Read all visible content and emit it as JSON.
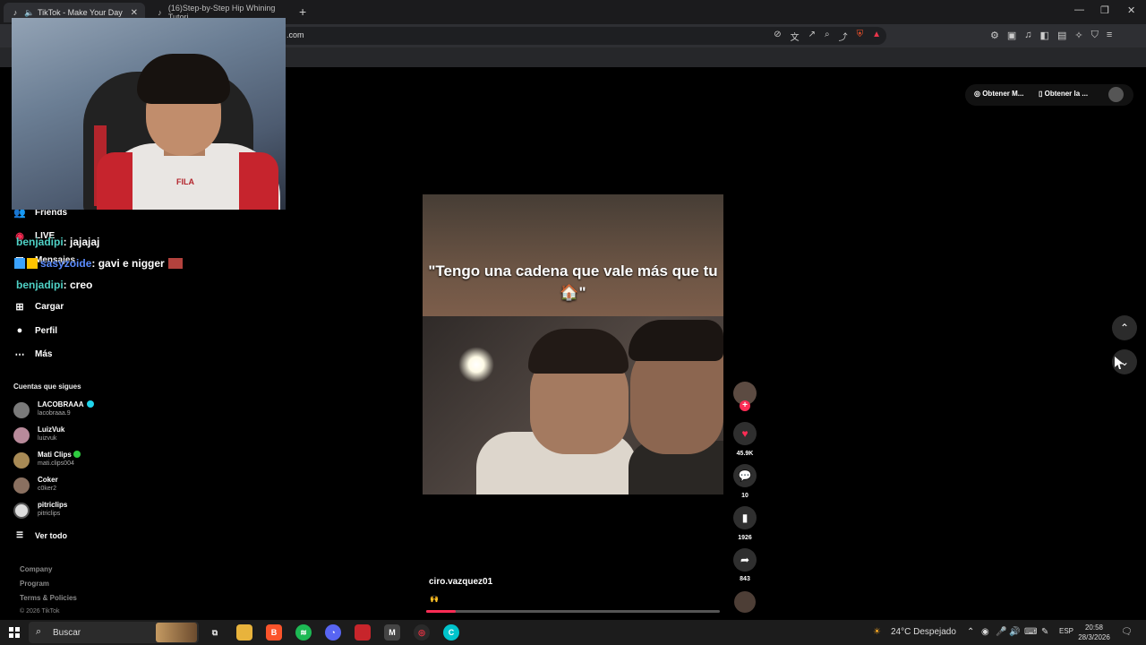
{
  "browser": {
    "tabs": [
      {
        "title": "TikTok - Make Your Day",
        "active": true
      },
      {
        "title": "(16)Step-by-Step Hip Whining Tutori",
        "active": false
      }
    ],
    "url_suffix": ".com",
    "new_tab_icon": "+"
  },
  "sidebar": {
    "items": [
      {
        "label": "Friends",
        "icon": "friends-icon"
      },
      {
        "label": "LIVE",
        "icon": "live-icon"
      },
      {
        "label": "Mensajes",
        "icon": "message-icon"
      },
      {
        "label": "Cargar",
        "icon": "upload-icon"
      },
      {
        "label": "Perfil",
        "icon": "profile-icon"
      },
      {
        "label": "Más",
        "icon": "more-icon"
      }
    ],
    "following_title": "Cuentas que sigues",
    "accounts": [
      {
        "name": "LACOBRAAA",
        "handle": "lacobraaa.9",
        "verified": true
      },
      {
        "name": "LuizVuk",
        "handle": "luizvuk"
      },
      {
        "name": "Mati Clips",
        "handle": "mati.clips004",
        "live": true
      },
      {
        "name": "Coker",
        "handle": "c0ker2"
      },
      {
        "name": "pitriclips",
        "handle": "pitriclips"
      }
    ],
    "see_all": "Ver todo",
    "footer": [
      "Company",
      "Program",
      "Terms & Policies"
    ],
    "copyright": "© 2026 TikTok"
  },
  "chat": [
    {
      "user": "benjadipi",
      "message": ": jajajaj"
    },
    {
      "user": "sasyzoide",
      "message": ": gavi e nigger"
    },
    {
      "user": "benjadipi",
      "message": ": creo"
    }
  ],
  "top_actions": {
    "get_coins": "Obtener M...",
    "get_app": "Obtener la ..."
  },
  "video": {
    "caption": "\"Tengo una cadena que vale más que tu 🏠\"",
    "author": "ciro.vazquez01",
    "description": "🙌",
    "progress": 0.1
  },
  "actions": {
    "likes": "45.9K",
    "comments": "10",
    "saves": "1926",
    "shares": "843"
  },
  "taskbar": {
    "search_label": "Buscar",
    "weather": "24°C  Despejado",
    "language": "ESP",
    "time": "20:58",
    "date": "28/3/2026"
  }
}
